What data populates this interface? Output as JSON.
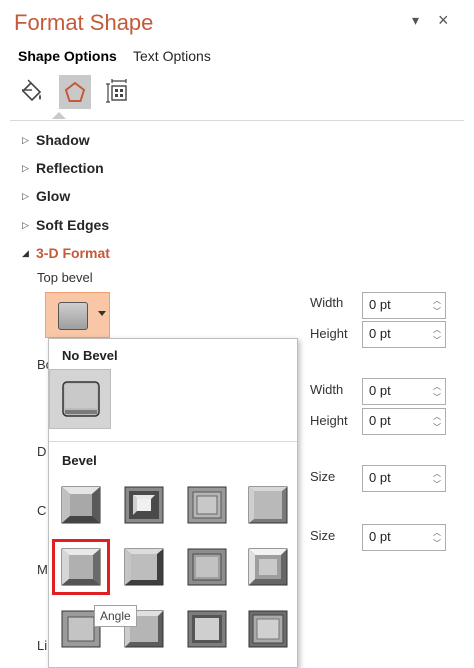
{
  "pane": {
    "title": "Format Shape",
    "pin_glyph": "▾",
    "close_glyph": "×"
  },
  "tabs": {
    "shape_options": "Shape Options",
    "text_options": "Text Options"
  },
  "icons": {
    "fill_line": "paint-bucket-icon",
    "effects": "pentagon-icon",
    "size_properties": "size-properties-icon"
  },
  "sections": {
    "shadow": "Shadow",
    "reflection": "Reflection",
    "glow": "Glow",
    "soft_edges": "Soft Edges",
    "format_3d": "3-D Format"
  },
  "top_bevel": {
    "label": "Top bevel",
    "width_label": "Width",
    "width_value": "0 pt",
    "height_label": "Height",
    "height_value": "0 pt"
  },
  "bottom_bevel": {
    "label_partial": "Bo",
    "width_label": "Width",
    "width_value": "0 pt",
    "height_label": "Height",
    "height_value": "0 pt"
  },
  "depth": {
    "label_partial": "D",
    "size_label": "Size",
    "size_value": "0 pt"
  },
  "contour": {
    "label_partial": "C",
    "size_label": "Size",
    "size_value": "0 pt"
  },
  "material": {
    "label_partial": "M"
  },
  "lighting": {
    "label_partial": "Li"
  },
  "gallery": {
    "no_bevel_heading": "No Bevel",
    "bevel_heading": "Bevel",
    "tooltip": "Angle",
    "selected": "Angle"
  },
  "colors": {
    "accent": "#c55a3a",
    "button_bg": "#f9c6a6",
    "selection": "#e02020"
  }
}
